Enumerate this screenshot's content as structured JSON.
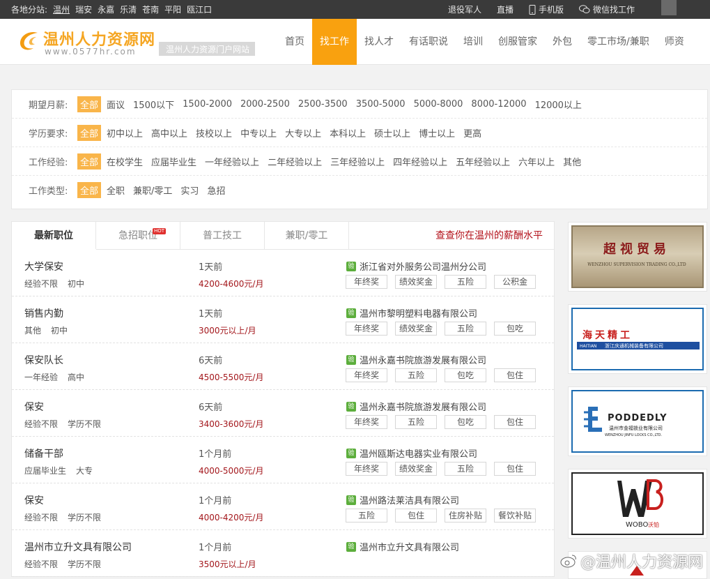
{
  "topbar": {
    "prefix": "各地分站:",
    "cities": [
      "温州",
      "瑞安",
      "永嘉",
      "乐清",
      "苍南",
      "平阳",
      "瓯江口"
    ],
    "links": [
      "退役军人",
      "直播",
      "手机版",
      "微信找工作"
    ]
  },
  "header": {
    "site_name": "温州人力资源网",
    "site_url": "www.0577hr.com",
    "slogan": "温州人力资源门户网站",
    "nav": [
      "首页",
      "找工作",
      "找人才",
      "有话职说",
      "培训",
      "创服管家",
      "外包",
      "零工市场/兼职",
      "师资"
    ],
    "nav_active": 1
  },
  "filters": [
    {
      "label": "期望月薪:",
      "options": [
        "全部",
        "面议",
        "1500以下",
        "1500-2000",
        "2000-2500",
        "2500-3500",
        "3500-5000",
        "5000-8000",
        "8000-12000",
        "12000以上"
      ]
    },
    {
      "label": "学历要求:",
      "options": [
        "全部",
        "初中以上",
        "高中以上",
        "技校以上",
        "中专以上",
        "大专以上",
        "本科以上",
        "硕士以上",
        "博士以上",
        "更高"
      ]
    },
    {
      "label": "工作经验:",
      "options": [
        "全部",
        "在校学生",
        "应届毕业生",
        "一年经验以上",
        "二年经验以上",
        "三年经验以上",
        "四年经验以上",
        "五年经验以上",
        "六年以上",
        "其他"
      ]
    },
    {
      "label": "工作类型:",
      "options": [
        "全部",
        "全职",
        "兼职/零工",
        "实习",
        "急招"
      ]
    }
  ],
  "tabs": {
    "items": [
      "最新职位",
      "急招职位",
      "普工技工",
      "兼职/零工"
    ],
    "hot_label": "HOT",
    "salary_link": "查查你在温州的薪酬水平"
  },
  "verified_badge": "验",
  "jobs": [
    {
      "title": "大学保安",
      "exp": "经验不限",
      "edu": "初中",
      "time": "1天前",
      "salary": "4200-4600元/月",
      "company": "浙江省对外服务公司温州分公司",
      "welfare": [
        "年终奖",
        "绩效奖金",
        "五险",
        "公积金"
      ]
    },
    {
      "title": "销售内勤",
      "exp": "其他",
      "edu": "初中",
      "time": "1天前",
      "salary": "3000元以上/月",
      "company": "温州市黎明塑料电器有限公司",
      "welfare": [
        "年终奖",
        "绩效奖金",
        "五险",
        "包吃"
      ]
    },
    {
      "title": "保安队长",
      "exp": "一年经验",
      "edu": "高中",
      "time": "6天前",
      "salary": "4500-5500元/月",
      "company": "温州永嘉书院旅游发展有限公司",
      "welfare": [
        "年终奖",
        "五险",
        "包吃",
        "包住"
      ]
    },
    {
      "title": "保安",
      "exp": "经验不限",
      "edu": "学历不限",
      "time": "6天前",
      "salary": "3400-3600元/月",
      "company": "温州永嘉书院旅游发展有限公司",
      "welfare": [
        "年终奖",
        "五险",
        "包吃",
        "包住"
      ]
    },
    {
      "title": "储备干部",
      "exp": "应届毕业生",
      "edu": "大专",
      "time": "1个月前",
      "salary": "4000-5000元/月",
      "company": "温州瓯斯达电器实业有限公司",
      "welfare": [
        "年终奖",
        "绩效奖金",
        "五险",
        "包住"
      ]
    },
    {
      "title": "保安",
      "exp": "经验不限",
      "edu": "学历不限",
      "time": "1个月前",
      "salary": "4000-4200元/月",
      "company": "温州路法莱洁具有限公司",
      "welfare": [
        "五险",
        "包住",
        "住房补贴",
        "餐饮补贴"
      ]
    },
    {
      "title": "温州市立升文具有限公司",
      "exp": "经验不限",
      "edu": "学历不限",
      "time": "1个月前",
      "salary": "3500元以上/月",
      "company": "温州市立升文具有限公司",
      "welfare": []
    }
  ],
  "ads": [
    {
      "cn": "超视贸易",
      "en": "WENZHOU SUPERVISION TRADING CO.,LTD"
    },
    {
      "cn": "海天精工",
      "en": "浙江庆通机械装备有限公司",
      "brand": "HAITIAN"
    },
    {
      "cn": "温州市金福锁业有限公司",
      "en": "WENZHOU JINFU LOCKS CO.,LTD.",
      "brand": "PODDEDLY"
    },
    {
      "brand": "WOBO",
      "cn": "沃铂"
    }
  ],
  "watermark": "@温州人力资源网",
  "colors": {
    "accent": "#f9a10f",
    "salary": "#a3161b",
    "topbar": "#3a3a3a",
    "verified": "#5cae3c"
  }
}
